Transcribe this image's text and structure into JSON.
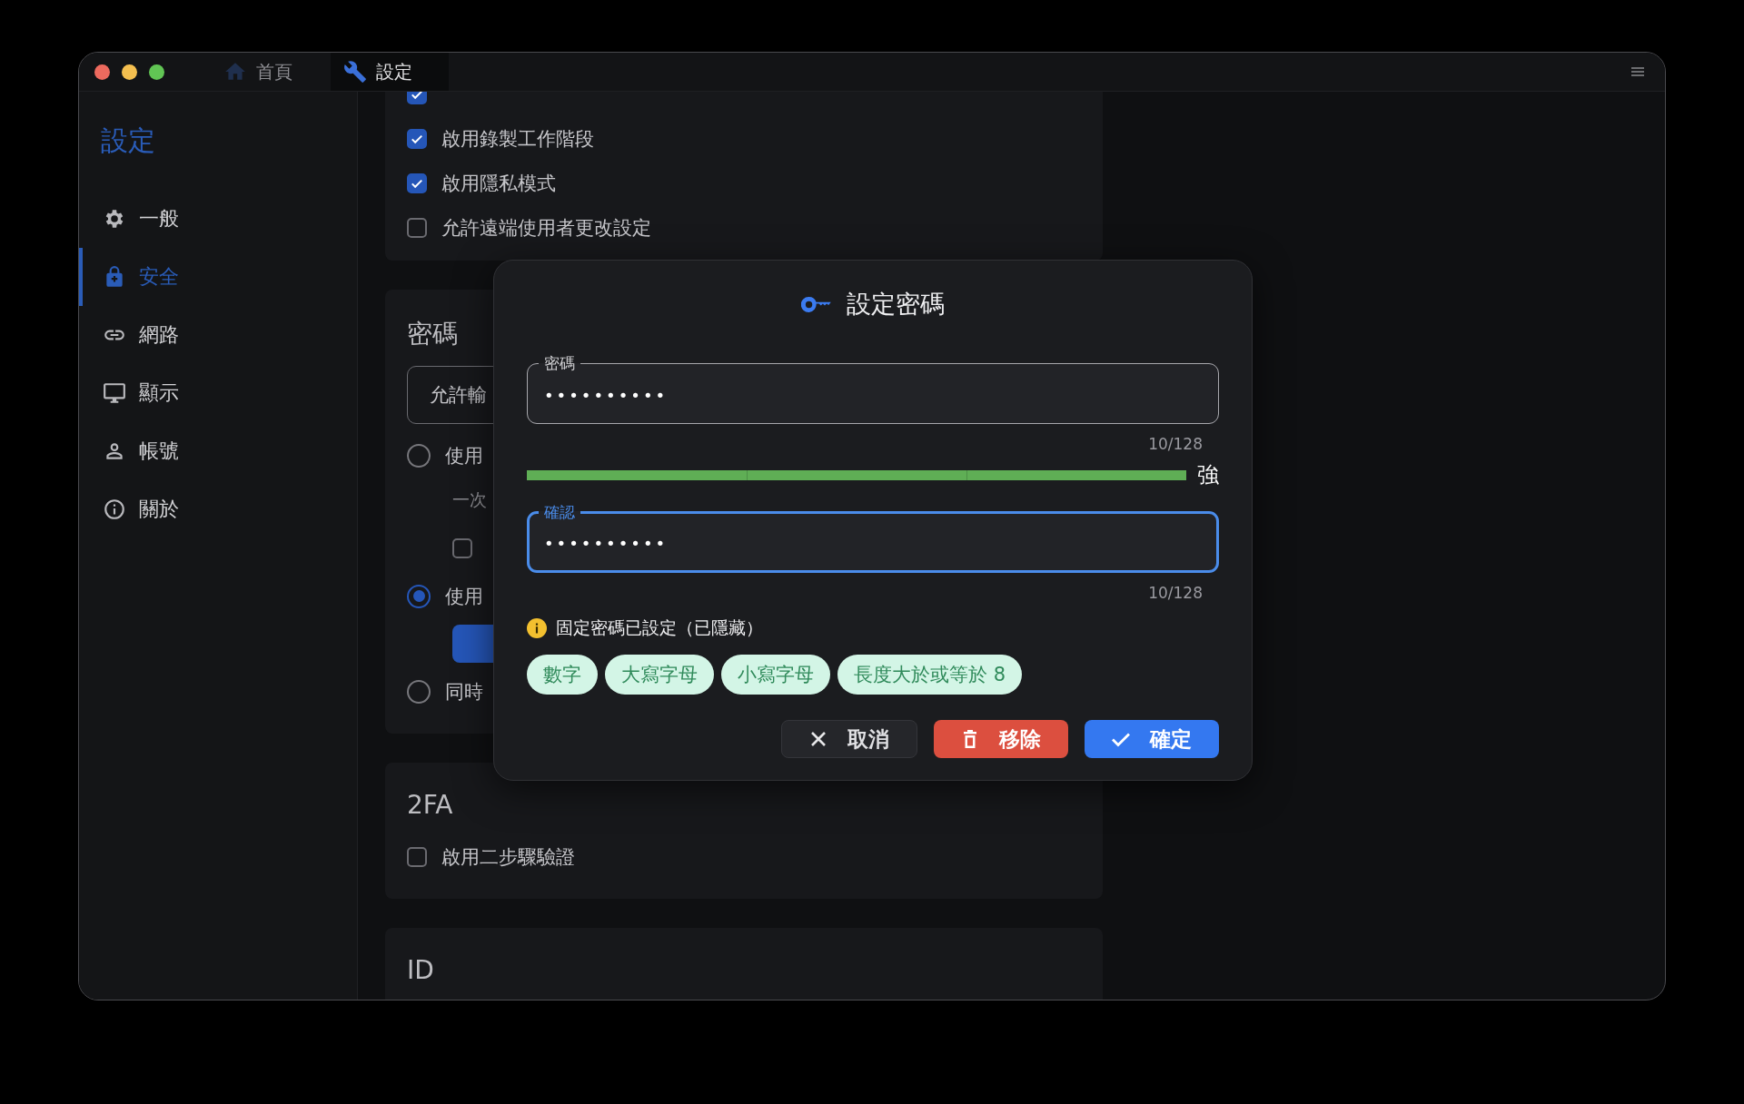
{
  "window": {
    "tabs": [
      {
        "label": "首頁",
        "selected": false
      },
      {
        "label": "設定",
        "selected": true
      }
    ]
  },
  "sidebar": {
    "title": "設定",
    "items": [
      {
        "label": "一般",
        "selected": false
      },
      {
        "label": "安全",
        "selected": true
      },
      {
        "label": "網路",
        "selected": false
      },
      {
        "label": "顯示",
        "selected": false
      },
      {
        "label": "帳號",
        "selected": false
      },
      {
        "label": "關於",
        "selected": false
      }
    ]
  },
  "sections": [
    {
      "items": [
        {
          "kind": "checkbox",
          "checked": true
        },
        {
          "kind": "checkbox",
          "label": "啟用錄製工作階段",
          "checked": true
        },
        {
          "kind": "checkbox",
          "label": "啟用隱私模式",
          "checked": true
        },
        {
          "kind": "checkbox",
          "label": "允許遠端使用者更改設定",
          "checked": false
        }
      ]
    },
    {
      "title": "密碼",
      "items": [
        {
          "kind": "select",
          "label": "允許輸"
        },
        {
          "kind": "radio",
          "label": "使用",
          "selected": false
        },
        {
          "kind": "hint",
          "label": "一次"
        },
        {
          "kind": "subcheckbox",
          "checked": false
        },
        {
          "kind": "radio",
          "label": "使用",
          "selected": true
        },
        {
          "kind": "button"
        },
        {
          "kind": "radio",
          "label": "同時",
          "selected": false
        }
      ]
    },
    {
      "title": "2FA",
      "items": [
        {
          "kind": "checkbox",
          "label": "啟用二步驟驗證",
          "checked": false
        }
      ]
    },
    {
      "title": "ID"
    }
  ],
  "dialog": {
    "title": "設定密碼",
    "password": {
      "label": "密碼",
      "value": "••••••••••",
      "counter": "10/128",
      "focused": false
    },
    "strength": {
      "level": 1,
      "label": "強"
    },
    "confirm": {
      "label": "確認",
      "value": "••••••••••",
      "counter": "10/128",
      "focused": true
    },
    "notice": "固定密碼已設定（已隱藏）",
    "chips": [
      "數字",
      "大寫字母",
      "小寫字母",
      "長度大於或等於 8"
    ],
    "buttons": [
      {
        "kind": "cancel",
        "label": "取消"
      },
      {
        "kind": "remove",
        "label": "移除"
      },
      {
        "kind": "confirm",
        "label": "確定"
      }
    ]
  }
}
